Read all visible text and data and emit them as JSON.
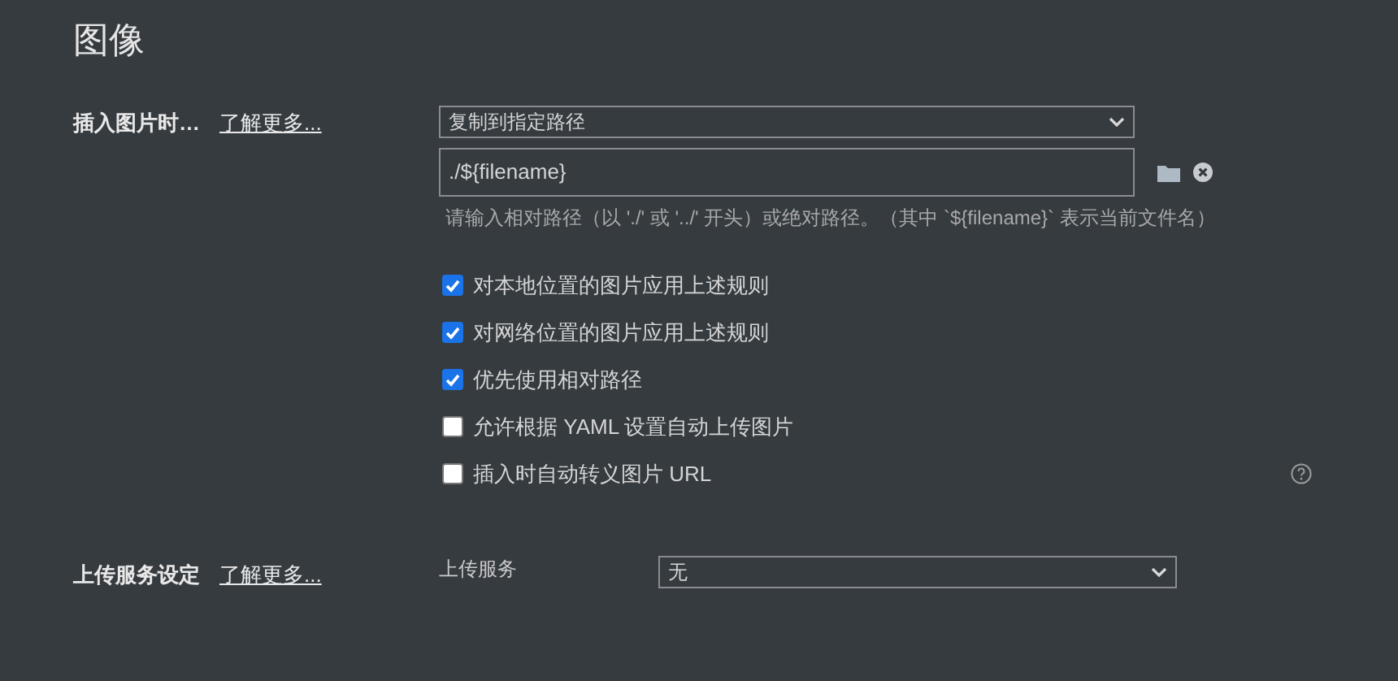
{
  "title": "图像",
  "insert_section": {
    "label": "插入图片时…",
    "learn_more": "了解更多...",
    "action_select": {
      "value": "复制到指定路径"
    },
    "path_field": {
      "value": "./${filename}"
    },
    "hint": "请输入相对路径（以 './' 或 '../' 开头）或绝对路径。（其中 `${filename}` 表示当前文件名）",
    "options": [
      {
        "label": "对本地位置的图片应用上述规则",
        "checked": true
      },
      {
        "label": "对网络位置的图片应用上述规则",
        "checked": true
      },
      {
        "label": "优先使用相对路径",
        "checked": true
      },
      {
        "label": "允许根据 YAML 设置自动上传图片",
        "checked": false
      },
      {
        "label": "插入时自动转义图片 URL",
        "checked": false
      }
    ]
  },
  "upload_section": {
    "label": "上传服务设定",
    "learn_more": "了解更多...",
    "service_label": "上传服务",
    "service_select": {
      "value": "无"
    }
  }
}
